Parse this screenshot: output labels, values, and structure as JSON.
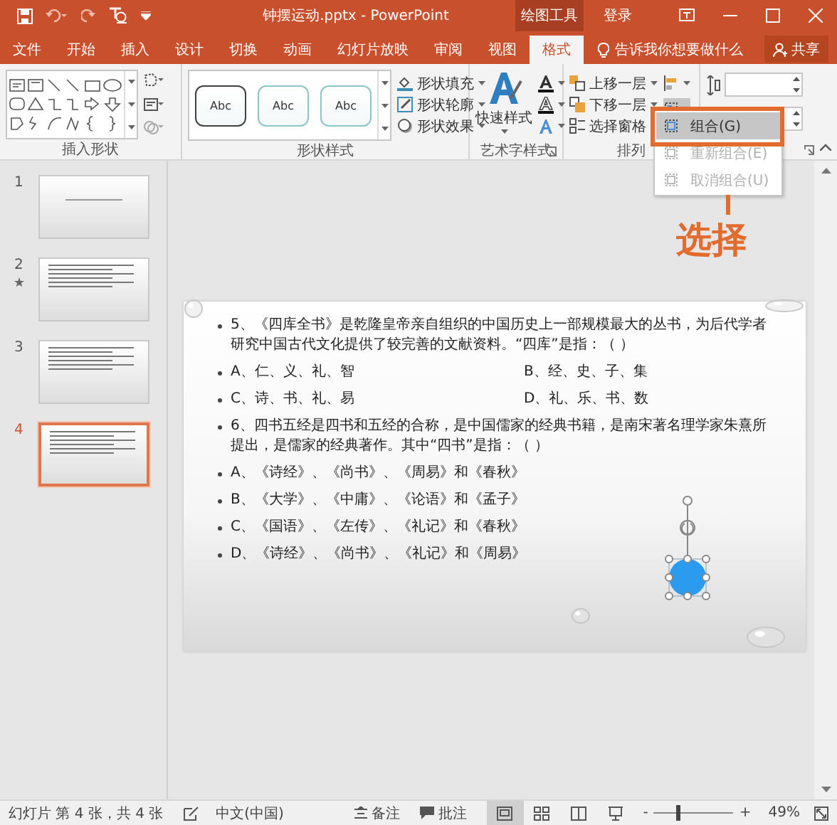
{
  "window": {
    "title": "钟摆运动.pptx - PowerPoint",
    "contextual_tab": "绘图工具",
    "account": "登录"
  },
  "tabs": [
    {
      "label": "文件",
      "selected": false
    },
    {
      "label": "开始",
      "selected": false
    },
    {
      "label": "插入",
      "selected": false
    },
    {
      "label": "设计",
      "selected": false
    },
    {
      "label": "切换",
      "selected": false
    },
    {
      "label": "动画",
      "selected": false
    },
    {
      "label": "幻灯片放映",
      "selected": false
    },
    {
      "label": "审阅",
      "selected": false
    },
    {
      "label": "视图",
      "selected": false
    },
    {
      "label": "格式",
      "selected": true
    }
  ],
  "tell_me": {
    "placeholder": "告诉我你想要做什么"
  },
  "share_button": {
    "label": "共享"
  },
  "ribbon": {
    "groups": [
      {
        "kind": "insert_shapes",
        "label": "插入形状"
      },
      {
        "kind": "shape_styles",
        "label": "形状样式",
        "styles": [
          {
            "text": "Abc",
            "color": "#404040"
          },
          {
            "text": "Abc",
            "color": "#8cc4c8"
          },
          {
            "text": "Abc",
            "color": "#8cc4c8"
          }
        ],
        "commands": [
          "形状填充",
          "形状轮廓",
          "形状效果"
        ]
      },
      {
        "kind": "wordart",
        "label": "艺术字样式",
        "quick_styles": "快速样式"
      },
      {
        "kind": "arrange",
        "label": "排列",
        "commands": [
          "上移一层",
          "下移一层",
          "选择窗格"
        ]
      },
      {
        "kind": "size"
      }
    ]
  },
  "dropdown_menu": {
    "items": [
      {
        "label": "组合(G)",
        "selected": true,
        "disabled": false
      },
      {
        "label": "重新组合(E)",
        "selected": false,
        "disabled": true
      },
      {
        "label": "取消组合(U)",
        "selected": false,
        "disabled": true
      }
    ]
  },
  "callout": {
    "text": "选择"
  },
  "slides": [
    {
      "number": "1",
      "selected": false,
      "animated": false
    },
    {
      "number": "2",
      "selected": false,
      "animated": true
    },
    {
      "number": "3",
      "selected": false,
      "animated": false
    },
    {
      "number": "4",
      "selected": true,
      "animated": false
    }
  ],
  "slide": {
    "content": [
      {
        "kind": "paragraph",
        "text": "5、《四库全书》是乾隆皇帝亲自组织的中国历史上一部规模最大的丛书，为后代学者研究中国古代文化提供了较完善的文献资料。“四库”是指：（ ）"
      },
      {
        "kind": "option_pair",
        "left": "A、仁、义、礼、智",
        "right": "B、经、史、子、集"
      },
      {
        "kind": "option_pair",
        "left": "C、诗、书、礼、易",
        "right": "D、礼、乐、书、数"
      },
      {
        "kind": "paragraph",
        "text": "6、四书五经是四书和五经的合称，是中国儒家的经典书籍，是南宋著名理学家朱熹所提出，是儒家的经典著作。其中“四书”是指：（ ）"
      },
      {
        "kind": "option",
        "text": "A、《诗经》、《尚书》、《周易》和《春秋》"
      },
      {
        "kind": "option",
        "text": "B、《大学》、《中庸》、《论语》和《孟子》"
      },
      {
        "kind": "option",
        "text": "C、《国语》、《左传》、《礼记》和《春秋》"
      },
      {
        "kind": "option",
        "text": "D、《诗经》、《尚书》、《礼记》和《周易》"
      }
    ]
  },
  "status_bar": {
    "slide_info": "幻灯片 第 4 张，共 4 张",
    "language": "中文(中国)",
    "notes": "备注",
    "comments": "批注",
    "view_buttons": [
      {
        "kind": "normal",
        "selected": true
      },
      {
        "kind": "sorter",
        "selected": false
      },
      {
        "kind": "reading",
        "selected": false
      },
      {
        "kind": "slideshow",
        "selected": false
      }
    ],
    "zoom_out": "-",
    "zoom_slider": {
      "level": 0.3
    },
    "zoom_in": "+",
    "zoom": "49%"
  }
}
